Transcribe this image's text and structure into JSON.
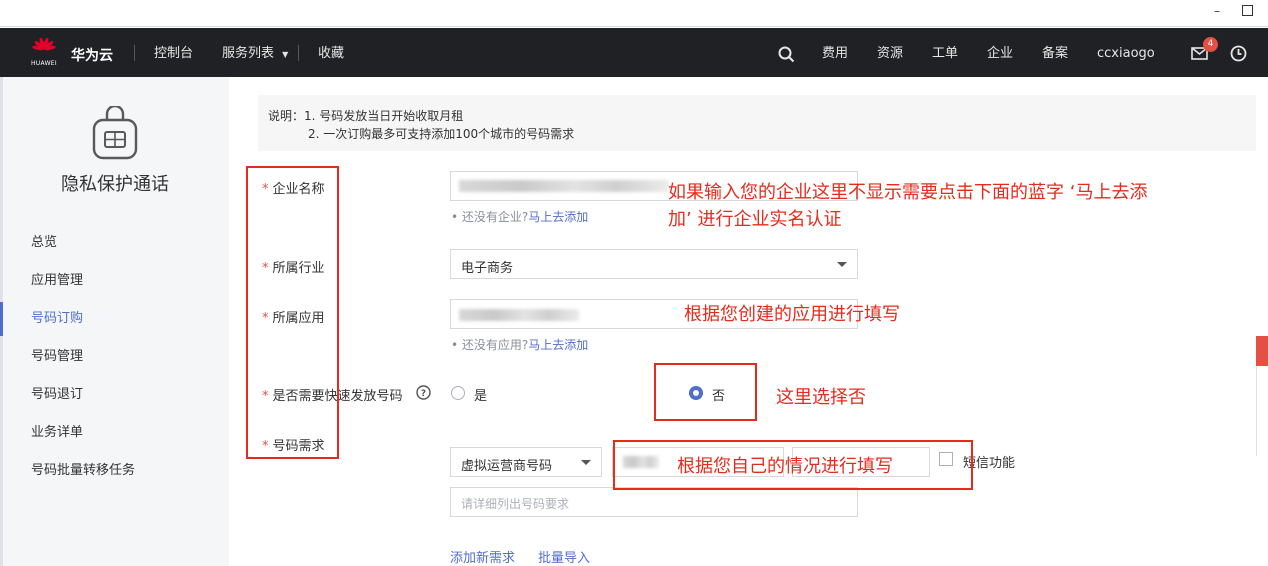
{
  "topnav": {
    "logo_text": "HUAWEI",
    "brand": "华为云",
    "console": "控制台",
    "services": "服务列表",
    "favorites": "收藏",
    "fees": "费用",
    "resources": "资源",
    "tickets": "工单",
    "enterprise": "企业",
    "filing": "备案",
    "username": "ccxiaogo",
    "message_count": "4"
  },
  "sidebar": {
    "title": "隐私保护通话",
    "items": [
      {
        "label": "总览"
      },
      {
        "label": "应用管理"
      },
      {
        "label": "号码订购"
      },
      {
        "label": "号码管理"
      },
      {
        "label": "号码退订"
      },
      {
        "label": "业务详单"
      },
      {
        "label": "号码批量转移任务"
      }
    ],
    "active_index": 2
  },
  "notice": {
    "line1": "说明：1. 号码发放当日开始收取月租",
    "line2": "2. 一次订购最多可支持添加100个城市的号码需求"
  },
  "form": {
    "company_label": "企业名称",
    "company_hint": "• 还没有企业?",
    "company_link": "马上去添加",
    "industry_label": "所属行业",
    "industry_value": "电子商务",
    "app_label": "所属应用",
    "app_hint": "• 还没有应用?",
    "app_link": "马上去添加",
    "fast_label": "是否需要快速发放号码",
    "fast_yes": "是",
    "fast_no": "否",
    "fast_selected": "否",
    "demand_label": "号码需求",
    "number_type": "虚拟运营商号码",
    "sms_label": "短信功能",
    "demand_placeholder": "请详细列出号码要求",
    "add_demand": "添加新需求",
    "batch_import": "批量导入"
  },
  "annotations": {
    "company_note_1": "如果输入您的企业这里不显示需要点击下面的蓝字 ‘马上去添",
    "company_note_2": "加’ 进行企业实名认证",
    "app_note": "根据您创建的应用进行填写",
    "fast_note": "这里选择否",
    "demand_note": "根据您自己的情况进行填写"
  },
  "colors": {
    "nav_bg": "#202125",
    "accent": "#526ecc",
    "required": "#e64f44",
    "annotation_red": "#e62b1c"
  }
}
